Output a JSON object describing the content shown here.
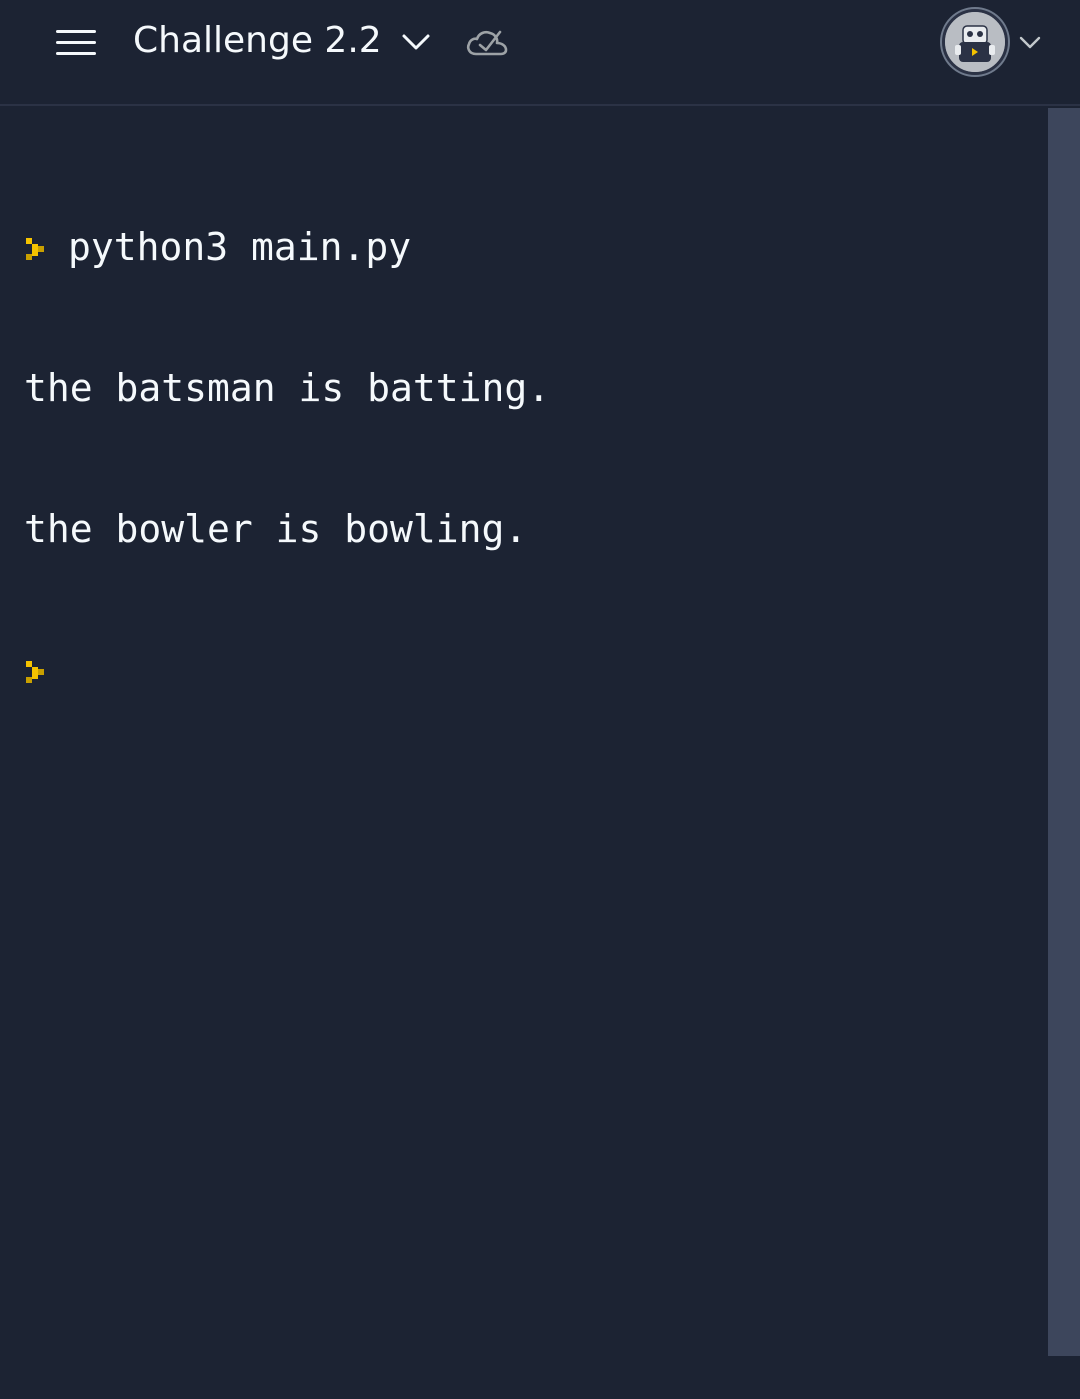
{
  "header": {
    "title": "Challenge 2.2",
    "menu_icon": "hamburger-menu-icon",
    "title_dropdown_icon": "chevron-down-icon",
    "cloud_icon": "cloud-check-icon",
    "avatar_icon": "robot-avatar",
    "avatar_dropdown_icon": "chevron-down-icon"
  },
  "console": {
    "prompt_color": "#f5c300",
    "command": "python3 main.py",
    "output": [
      "the batsman is batting.",
      "the bowler is bowling."
    ]
  },
  "colors": {
    "background": "#1c2333",
    "text": "#f5f9fc",
    "scrollbar": "#3d465c"
  }
}
